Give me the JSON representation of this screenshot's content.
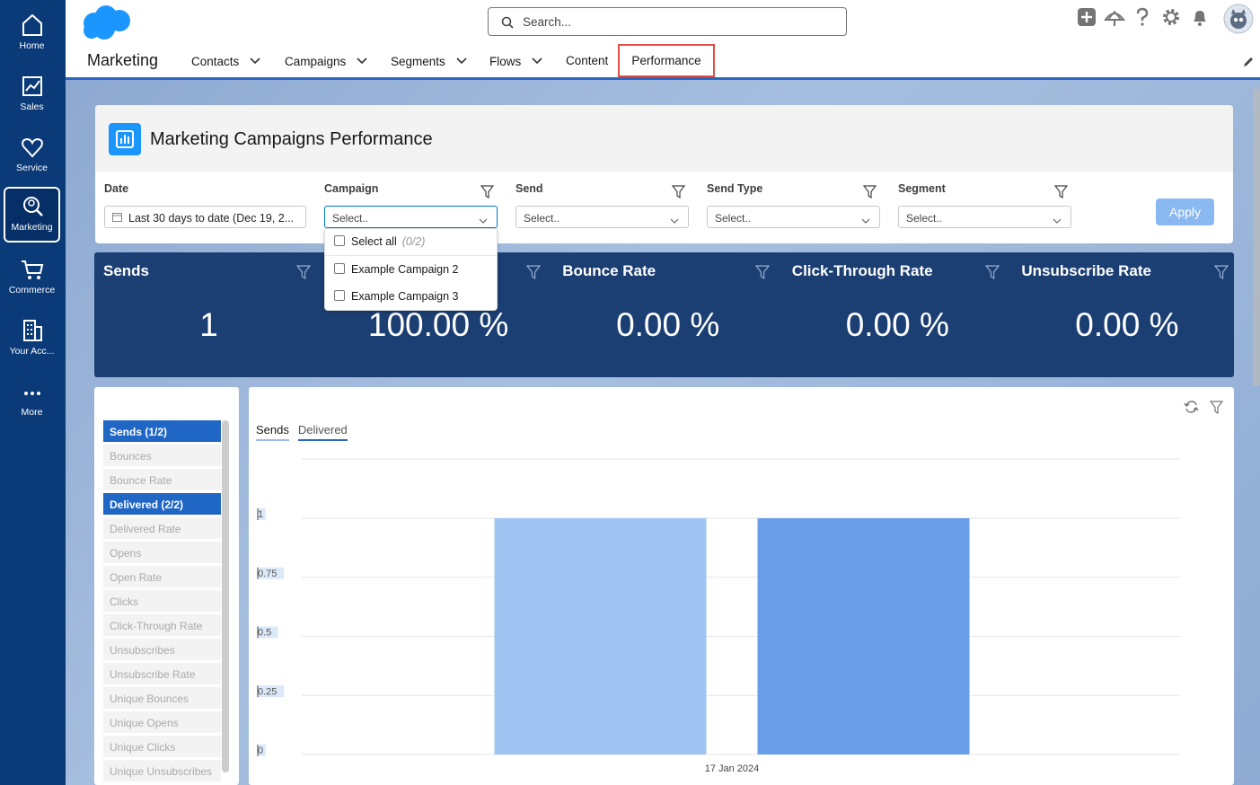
{
  "rail": {
    "items": [
      {
        "label": "Home",
        "icon": "home-icon"
      },
      {
        "label": "Sales",
        "icon": "chart-icon"
      },
      {
        "label": "Service",
        "icon": "heart-icon"
      },
      {
        "label": "Marketing",
        "icon": "search-people-icon",
        "active": true
      },
      {
        "label": "Commerce",
        "icon": "cart-icon"
      },
      {
        "label": "Your Acc...",
        "icon": "building-icon"
      },
      {
        "label": "More",
        "icon": "more-icon"
      }
    ]
  },
  "search": {
    "placeholder": "Search..."
  },
  "app": {
    "name": "Marketing"
  },
  "nav": {
    "contacts": "Contacts",
    "campaigns": "Campaigns",
    "segments": "Segments",
    "flows": "Flows",
    "content": "Content",
    "performance": "Performance"
  },
  "panel": {
    "title": "Marketing Campaigns Performance"
  },
  "filters": {
    "date": {
      "label": "Date",
      "value": "Last 30 days to date (Dec 19, 2..."
    },
    "campaign": {
      "label": "Campaign",
      "value": "Select.."
    },
    "send": {
      "label": "Send",
      "value": "Select.."
    },
    "send_type": {
      "label": "Send Type",
      "value": "Select.."
    },
    "segment": {
      "label": "Segment",
      "value": "Select.."
    },
    "apply": "Apply"
  },
  "dropdown": {
    "select_all": "Select all",
    "select_all_count": "(0/2)",
    "options": [
      "Example Campaign 2",
      "Example Campaign 3"
    ]
  },
  "kpis": [
    {
      "title": "Sends",
      "value": "1"
    },
    {
      "title": "",
      "value": "100.00 %"
    },
    {
      "title": "Bounce Rate",
      "value": "0.00 %"
    },
    {
      "title": "Click-Through Rate",
      "value": "0.00 %"
    },
    {
      "title": "Unsubscribe Rate",
      "value": "0.00 %"
    }
  ],
  "metrics": [
    {
      "label": "Sends (1/2)",
      "selected": true
    },
    {
      "label": "Bounces"
    },
    {
      "label": "Bounce Rate"
    },
    {
      "label": "Delivered (2/2)",
      "selected": true
    },
    {
      "label": "Delivered Rate"
    },
    {
      "label": "Opens"
    },
    {
      "label": "Open Rate"
    },
    {
      "label": "Clicks"
    },
    {
      "label": "Click-Through Rate"
    },
    {
      "label": "Unsubscribes"
    },
    {
      "label": "Unsubscribe Rate"
    },
    {
      "label": "Unique Bounces"
    },
    {
      "label": "Unique Opens"
    },
    {
      "label": "Unique Clicks"
    },
    {
      "label": "Unique Unsubscribes"
    }
  ],
  "chart_tabs": [
    "Sends",
    "Delivered"
  ],
  "colors": {
    "rail": "#0b3a78",
    "kpi": "#1c3f73",
    "accent": "#2a67c2",
    "series1": "#a0c4f2",
    "series2": "#6a9ee8"
  },
  "chart_data": {
    "type": "bar",
    "categories": [
      "17 Jan 2024"
    ],
    "series": [
      {
        "name": "Sends",
        "values": [
          1
        ],
        "color": "#a0c4f2"
      },
      {
        "name": "Delivered",
        "values": [
          1
        ],
        "color": "#6a9ee8"
      }
    ],
    "ylim": [
      0,
      1
    ],
    "yticks": [
      "0",
      "0.25",
      "0.5",
      "0.75",
      "1"
    ],
    "grid": true
  }
}
